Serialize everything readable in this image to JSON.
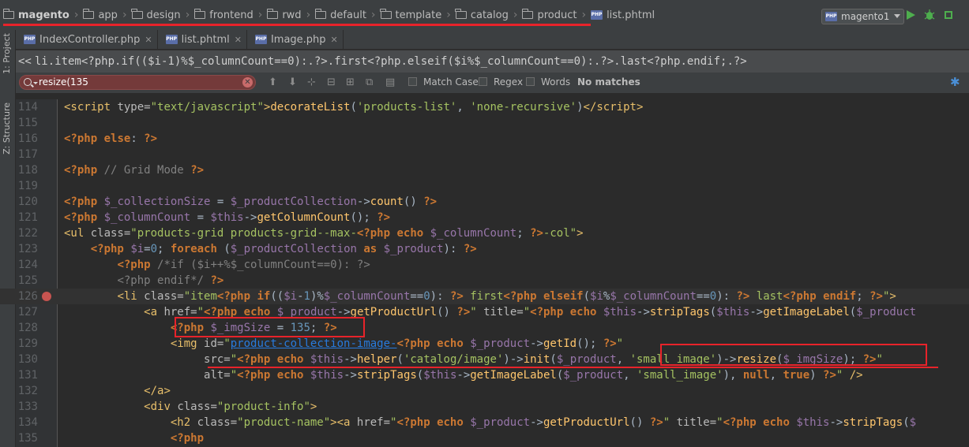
{
  "breadcrumb": {
    "root": "magento",
    "items": [
      "app",
      "design",
      "frontend",
      "rwd",
      "default",
      "template",
      "catalog",
      "product"
    ],
    "file": "list.phtml"
  },
  "toolbar": {
    "run_config": "magento1",
    "icons": [
      "run-icon",
      "debug-icon",
      "stop-icon"
    ]
  },
  "side_tabs": [
    "1: Project",
    "Z: Structure"
  ],
  "tabs": [
    {
      "label": "IndexController.php",
      "active": false
    },
    {
      "label": "list.phtml",
      "active": true
    },
    {
      "label": "Image.php",
      "active": false
    }
  ],
  "context_line": "li.item<?php.if(($i-1)%$_columnCount==0):.?>.first<?php.elseif($i%$_columnCount==0):.?>.last<?php.endif;.?>",
  "find": {
    "query": "resize(135",
    "match_case": "Match Case",
    "regex": "Regex",
    "words": "Words",
    "status": "No matches"
  },
  "editor": {
    "line_numbers": [
      "114",
      "115",
      "116",
      "117",
      "118",
      "119",
      "120",
      "121",
      "122",
      "123",
      "124",
      "125",
      "126",
      "127",
      "128",
      "129",
      "130",
      "131",
      "132",
      "133",
      "134",
      "135"
    ],
    "breakpoint_line": "126",
    "highlighted_line": "126"
  },
  "colors": {
    "keyword": "#cc7832",
    "string": "#a5c261",
    "variable": "#9876aa",
    "function": "#ffc66d",
    "tag": "#e8bf6a",
    "annotation_red": "#e8232a"
  }
}
